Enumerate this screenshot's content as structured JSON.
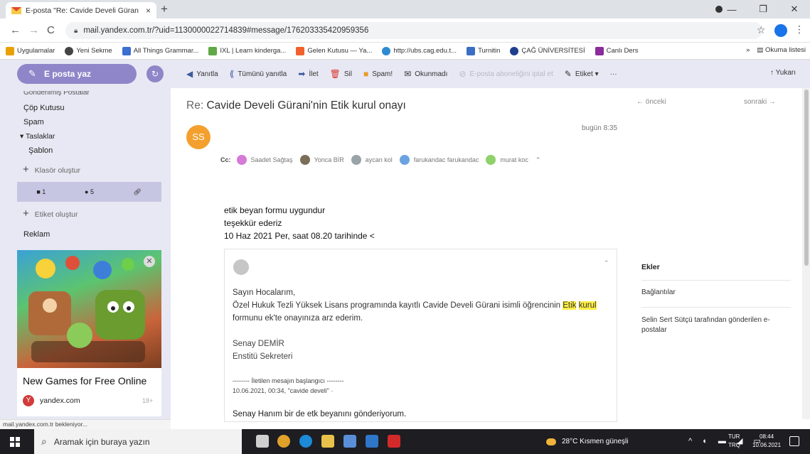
{
  "browser": {
    "tab_title": "E-posta \"Re: Cavide Develi Güran",
    "tab_close": "×",
    "new_tab": "+",
    "url": "mail.yandex.com.tr/?uid=1130000022714839#message/176203335420959356",
    "bookmarks": [
      {
        "label": "Uygulamalar",
        "color": "#e8a200"
      },
      {
        "label": "Yeni Sekme",
        "color": "#444"
      },
      {
        "label": "All Things Grammar...",
        "color": "#3b6fd1"
      },
      {
        "label": "IXL | Learn kinderga...",
        "color": "#5fa843"
      },
      {
        "label": "Gelen Kutusu — Ya...",
        "color": "#f0612d"
      },
      {
        "label": "http://ubs.cag.edu.t...",
        "color": "#2d8bd1"
      },
      {
        "label": "Turnitin",
        "color": "#3a6ec4"
      },
      {
        "label": "ÇAĞ ÜNİVERSİTESİ",
        "color": "#1f3f8c"
      },
      {
        "label": "Canlı Ders",
        "color": "#8a2c9b"
      }
    ],
    "bookmarks_overflow": "»",
    "reading_list": "Okuma listesi",
    "status_text": "mail.yandex.com.tr bekleniyor..."
  },
  "sidebar": {
    "compose_label": "E posta yaz",
    "folders": {
      "sent": "Gönderilmiş Postalar",
      "trash": "Çöp Kutusu",
      "spam": "Spam",
      "drafts": "▾ Taslaklar",
      "templates": "Şablon"
    },
    "create_folder": "Klasör oluştur",
    "filters": {
      "flag_count": "1",
      "unread_count": "5"
    },
    "create_label": "Etiket oluştur",
    "ads_heading": "Reklam"
  },
  "ad": {
    "title": "New Games for Free Online",
    "domain": "yandex.com",
    "age_rating": "18+"
  },
  "toolbar": {
    "reply": "Yanıtla",
    "reply_all": "Tümünü yanıtla",
    "forward": "İlet",
    "delete": "Sil",
    "spam": "Spam!",
    "unread": "Okunmadı",
    "unsubscribe": "E-posta aboneliğini iptal et",
    "label": "Etiket ▾",
    "more": "···",
    "up": "Yukarı"
  },
  "message": {
    "subject_prefix": "Re:",
    "subject": "Cavide Develi Gürani'nin Etik kurul onayı",
    "prev": "önceki",
    "next": "sonraki",
    "sender_initials": "SS",
    "date": "bugün 8:35",
    "cc_label": "Cc:",
    "cc": [
      {
        "name": "Saadet Sağtaş",
        "color": "#d57ad7"
      },
      {
        "name": "Yonca BİR",
        "color": "#7c6f5a"
      },
      {
        "name": "aycan kol",
        "color": "#9aa3a8"
      },
      {
        "name": "farukandac farukandac",
        "color": "#6aa3e0"
      },
      {
        "name": "murat koc",
        "color": "#8fd16a"
      }
    ],
    "cc_more": "⌃",
    "body": [
      "etik beyan formu uygundur",
      "teşekkür ederiz",
      "10 Haz 2021 Per, saat 08.20 tarihinde <"
    ]
  },
  "quote": {
    "greeting": "Sayın Hocalarım,",
    "line_before": "Özel Hukuk Tezli Yüksek Lisans programında kayıtlı Cavide Develi Gürani isimli öğrencinin",
    "highlight_1": "Etik",
    "highlight_2": "kurul",
    "line_after": "formunu ek'te onayınıza arz ederim.",
    "sig_name": "Senay DEMİR",
    "sig_title": "Enstitü Sekreteri",
    "forward_header": "-------- İletilen mesajın başlangıcı --------",
    "forward_meta": "10.06.2021, 00:34, \"cavide develi\" ·",
    "last_line": "Senay Hanım bir de etk beyanını gönderiyorum."
  },
  "aside": {
    "attachments": "Ekler",
    "links": "Bağlantılar",
    "other_mails": "Selin Sert Sütçü tarafından gönderilen e-postalar"
  },
  "taskbar": {
    "search_placeholder": "Aramak için buraya yazın",
    "weather": "28°C  Kısmen güneşli",
    "lang_top": "TUR",
    "lang_bottom": "TRQ",
    "time": "08:44",
    "date": "10.06.2021",
    "apps": [
      {
        "name": "task-view-icon",
        "color": "#cfcfcf"
      },
      {
        "name": "chrome-icon",
        "color": "#e0a12a"
      },
      {
        "name": "edge-icon",
        "color": "#1c8ad6"
      },
      {
        "name": "file-explorer-icon",
        "color": "#e8c14a"
      },
      {
        "name": "store-icon",
        "color": "#5a8fd8"
      },
      {
        "name": "mail-icon",
        "color": "#2e76c8"
      },
      {
        "name": "acrobat-icon",
        "color": "#d22a2a"
      }
    ]
  }
}
